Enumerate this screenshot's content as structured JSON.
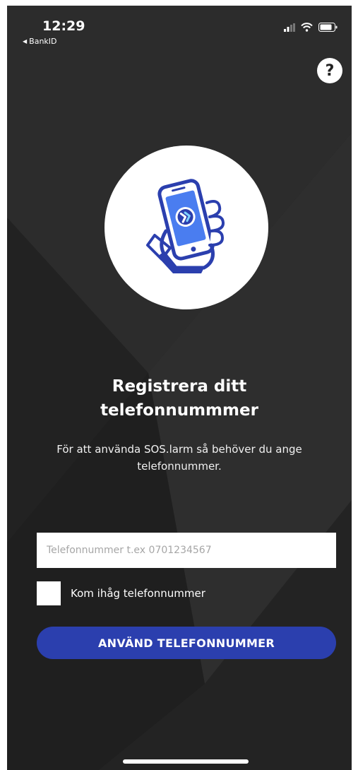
{
  "status_bar": {
    "time": "12:29",
    "back_app": "BankID",
    "signal_icon": "signal-icon",
    "wifi_icon": "wifi-icon",
    "battery_icon": "battery-icon"
  },
  "help": {
    "label": "?",
    "icon": "question-icon"
  },
  "hero": {
    "icon": "hand-holding-phone-icon",
    "accent_color": "#2b3fae",
    "screen_color": "#4a7df0"
  },
  "content": {
    "title_line1": "Registrera ditt",
    "title_line2": "telefonnummmer",
    "subtitle": "För att använda SOS.larm så behöver du ange telefonnummer."
  },
  "form": {
    "phone_placeholder": "Telefonnummer t.ex 0701234567",
    "phone_value": "",
    "remember_label": "Kom ihåg telefonnummer",
    "remember_checked": false,
    "submit_label": "ANVÄND TELEFONNUMMER"
  },
  "colors": {
    "background": "#262626",
    "button": "#2b3fae",
    "text": "#ffffff"
  }
}
